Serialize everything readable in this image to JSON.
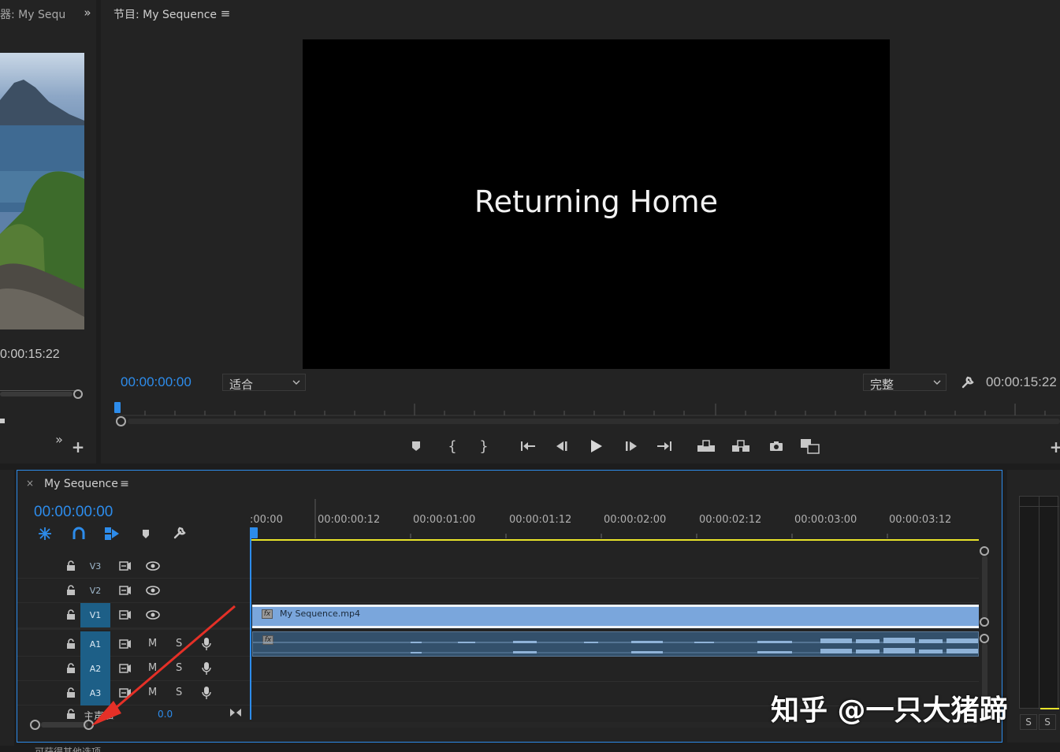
{
  "source_monitor": {
    "tab_title": "器: My Sequ",
    "timecode": "0:00:15:22"
  },
  "program_monitor": {
    "tab_title": "节目: My Sequence",
    "title_card_text": "Returning Home",
    "timecode_current": "00:00:00:00",
    "fit_select": "适合",
    "quality_select": "完整",
    "timecode_duration": "00:00:15:22"
  },
  "timeline": {
    "tab_title": "My Sequence",
    "timecode": "00:00:00:00",
    "ruler_labels": [
      ":00:00",
      "00:00:00:12",
      "00:00:01:00",
      "00:00:01:12",
      "00:00:02:00",
      "00:00:02:12",
      "00:00:03:00",
      "00:00:03:12"
    ],
    "tracks": {
      "v3": "V3",
      "v2": "V2",
      "v1": "V1",
      "a1": "A1",
      "a2": "A2",
      "a3": "A3"
    },
    "mute_label": "M",
    "solo_label": "S",
    "master_label": "主声道",
    "master_value": "0.0",
    "video_clip_name": "My Sequence.mp4",
    "fx_badge": "fx"
  },
  "audio_meter": {
    "solo_left": "S",
    "solo_right": "S"
  },
  "watermark": "知乎 @一只大猪蹄",
  "status_bar": "可获得其他选项",
  "colors": {
    "accent_blue": "#2d8ceb",
    "track_selected": "#1d5f87",
    "video_clip": "#7aa6dc",
    "audio_clip": "#33506b",
    "annotation_arrow": "#e53027",
    "work_area": "#e8e32a"
  }
}
